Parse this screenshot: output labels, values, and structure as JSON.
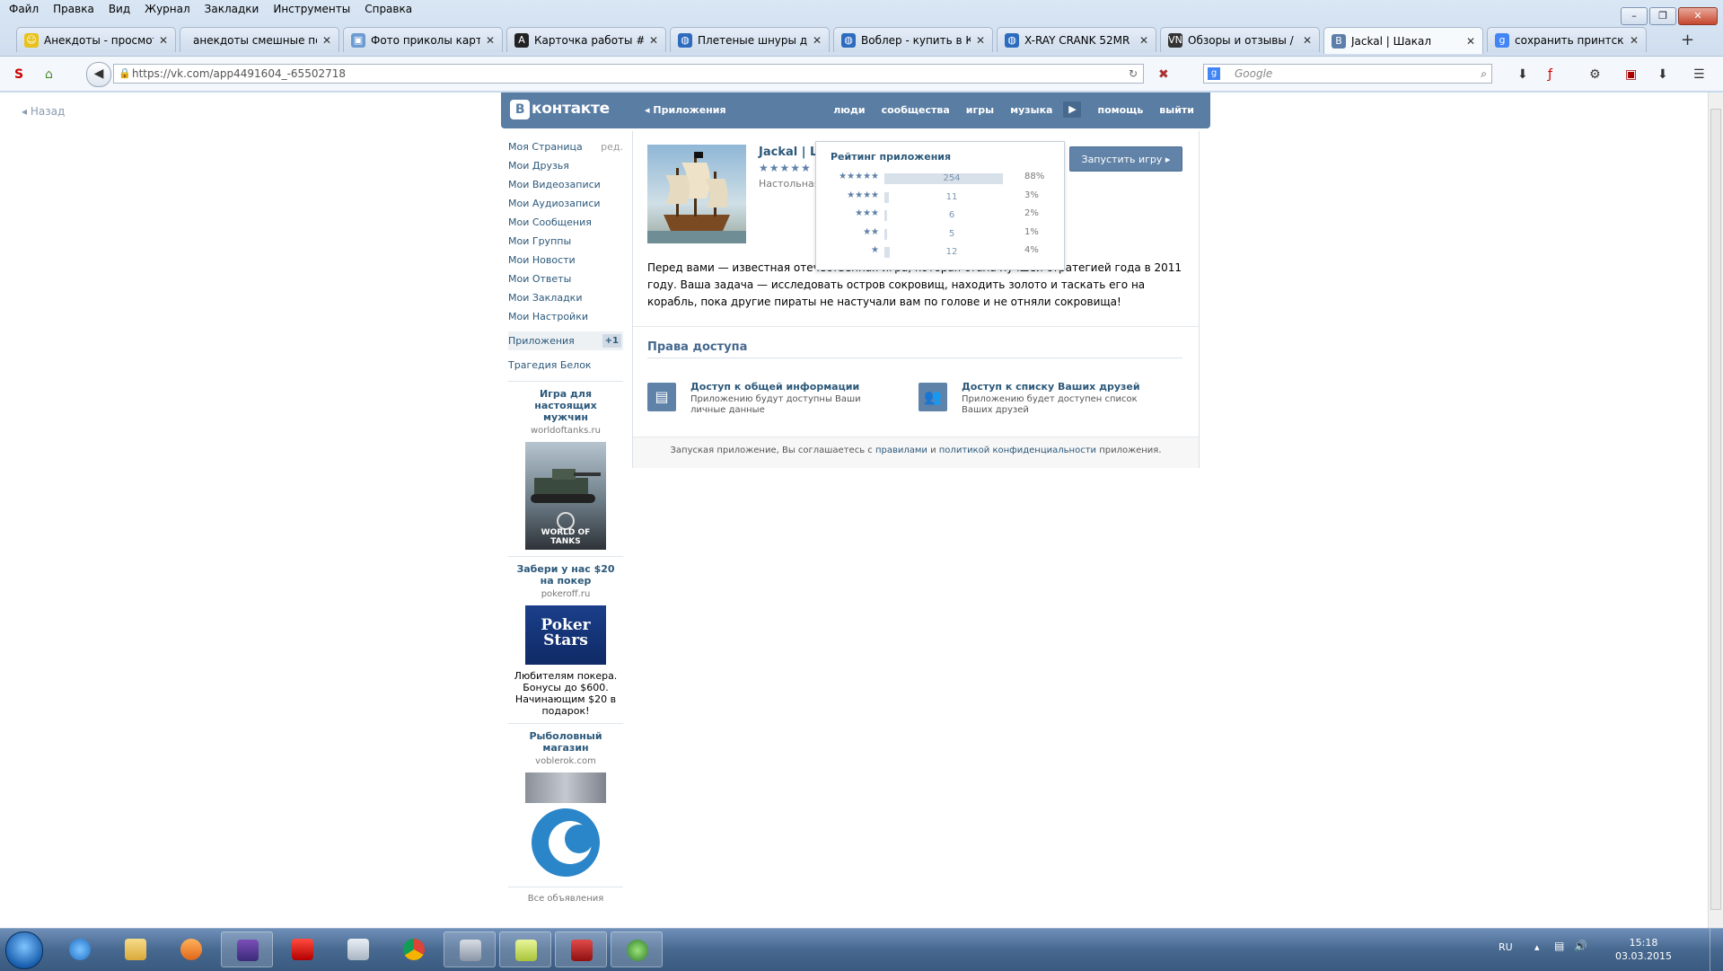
{
  "browser": {
    "menu": [
      "Файл",
      "Правка",
      "Вид",
      "Журнал",
      "Закладки",
      "Инструменты",
      "Справка"
    ],
    "tabs": [
      {
        "title": "Анекдоты - просмот...",
        "icon": "smiley"
      },
      {
        "title": "анекдоты смешные пош...",
        "icon": "none"
      },
      {
        "title": "Фото приколы карти...",
        "icon": "photo"
      },
      {
        "title": "Карточка работы #11...",
        "icon": "A"
      },
      {
        "title": "Плетеные шнуры дл...",
        "icon": "globe"
      },
      {
        "title": "Воблер - купить в Ки...",
        "icon": "globe"
      },
      {
        "title": "X-RAY CRANK 52MR",
        "icon": "globe"
      },
      {
        "title": "Обзоры и отзывы / Э...",
        "icon": "VN"
      },
      {
        "title": "Jackal | Шакал",
        "icon": "vk",
        "active": true
      },
      {
        "title": "сохранить принтскр...",
        "icon": "google"
      }
    ],
    "url_host": "https://vk.com",
    "url_path": "/app4491604_-65502718",
    "search_placeholder": "Google"
  },
  "page": {
    "back_link": "Назад",
    "header": {
      "logo": "контакте",
      "logo_letter": "В",
      "apps_link": "Приложения",
      "nav": [
        "люди",
        "сообщества",
        "игры",
        "музыка",
        "помощь",
        "выйти"
      ]
    },
    "menu": [
      {
        "label": "Моя Страница",
        "edit": "ред."
      },
      {
        "label": "Мои Друзья"
      },
      {
        "label": "Мои Видеозаписи"
      },
      {
        "label": "Мои Аудиозаписи"
      },
      {
        "label": "Мои Сообщения"
      },
      {
        "label": "Мои Группы"
      },
      {
        "label": "Мои Новости"
      },
      {
        "label": "Мои Ответы"
      },
      {
        "label": "Мои Закладки"
      },
      {
        "label": "Мои Настройки"
      }
    ],
    "apps_item": {
      "label": "Приложения",
      "count": "+1"
    },
    "extra_item": "Трагедия Белок",
    "ads": [
      {
        "title": "Игра для настоящих мужчин",
        "domain": "worldoftanks.ru",
        "img_text": "WORLD OF TANKS"
      },
      {
        "title": "Забери у нас $20 на покер",
        "domain": "pokeroff.ru",
        "img_text": "Poker Stars",
        "desc": "Любителям покера. Бонусы до $600. Начинающим $20 в подарок!"
      },
      {
        "title": "Рыболовный магазин",
        "domain": "voblerok.com"
      }
    ],
    "all_ads": "Все объявления",
    "app": {
      "title": "Jackal | Ш",
      "stars": "★★★★★",
      "category": "Настольная,",
      "run_button": "Запустить игру",
      "description": "Перед вами — известная отечественная игра, которая стала лучшей стратегией года в 2011 году. Ваша задача — исследовать остров сокровищ, находить золото и таскать его на корабль, пока другие пираты не настучали вам по голове и не отняли сокровища!",
      "perms_title": "Права доступа",
      "perms": [
        {
          "title": "Доступ к общей информации",
          "desc": "Приложению будут доступны Ваши личные данные",
          "icon": "profile-card-icon"
        },
        {
          "title": "Доступ к списку Ваших друзей",
          "desc": "Приложению будет доступен список Ваших друзей",
          "icon": "friends-icon"
        }
      ],
      "footer_prefix": "Запуская приложение, Вы соглашаетесь с ",
      "footer_link1": "правилами",
      "footer_and": " и ",
      "footer_link2": "политикой конфиденциальности",
      "footer_suffix": " приложения."
    },
    "rating": {
      "title": "Рейтинг приложения",
      "rows": [
        {
          "stars": "★★★★★",
          "count": "254",
          "percent": "88%",
          "share": 0.88
        },
        {
          "stars": "★★★★",
          "count": "11",
          "percent": "3%",
          "share": 0.03
        },
        {
          "stars": "★★★",
          "count": "6",
          "percent": "2%",
          "share": 0.02
        },
        {
          "stars": "★★",
          "count": "5",
          "percent": "1%",
          "share": 0.01
        },
        {
          "stars": "★",
          "count": "12",
          "percent": "4%",
          "share": 0.04
        }
      ]
    }
  },
  "taskbar": {
    "lang": "RU",
    "time": "15:18",
    "date": "03.03.2015"
  }
}
